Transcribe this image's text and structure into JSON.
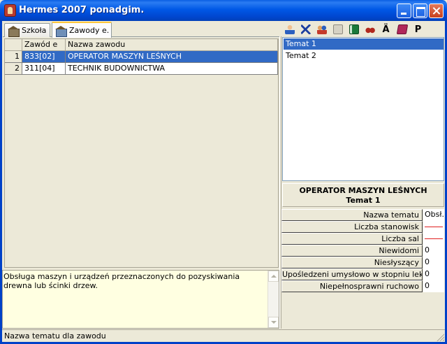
{
  "window": {
    "title": "Hermes 2007 ponadgim."
  },
  "tabs": [
    {
      "label": "Szkoła",
      "icon": "building-icon"
    },
    {
      "label": "Zawody e.",
      "icon": "building-icon"
    }
  ],
  "toolbar": {
    "a_label": "Ä",
    "p_label": "P"
  },
  "table": {
    "headers": [
      "Zawód e",
      "Nazwa zawodu"
    ],
    "rows": [
      {
        "num": "1",
        "code": "833[02]",
        "name": "OPERATOR MASZYN LEŚNYCH"
      },
      {
        "num": "2",
        "code": "311[04]",
        "name": "TECHNIK BUDOWNICTWA"
      }
    ]
  },
  "description": "Obsługa maszyn i urządzeń przeznaczonych do pozyskiwania drewna lub ścinki drzew.",
  "topics": [
    "Temat 1",
    "Temat 2"
  ],
  "selected": {
    "zawod": "OPERATOR MASZYN LEŚNYCH",
    "temat": "Temat 1"
  },
  "properties": [
    {
      "label": "Nazwa tematu",
      "value": "Obsł..."
    },
    {
      "label": "Liczba stanowisk",
      "value": ""
    },
    {
      "label": "Liczba sal",
      "value": ""
    },
    {
      "label": "Niewidomi",
      "value": "0"
    },
    {
      "label": "Niesłyszący",
      "value": "0"
    },
    {
      "label": "Upośledzeni umysłowo w stopniu lekkim",
      "value": "0"
    },
    {
      "label": "Niepełnosprawni ruchowo",
      "value": "0"
    }
  ],
  "status": "Nazwa tematu dla zawodu"
}
